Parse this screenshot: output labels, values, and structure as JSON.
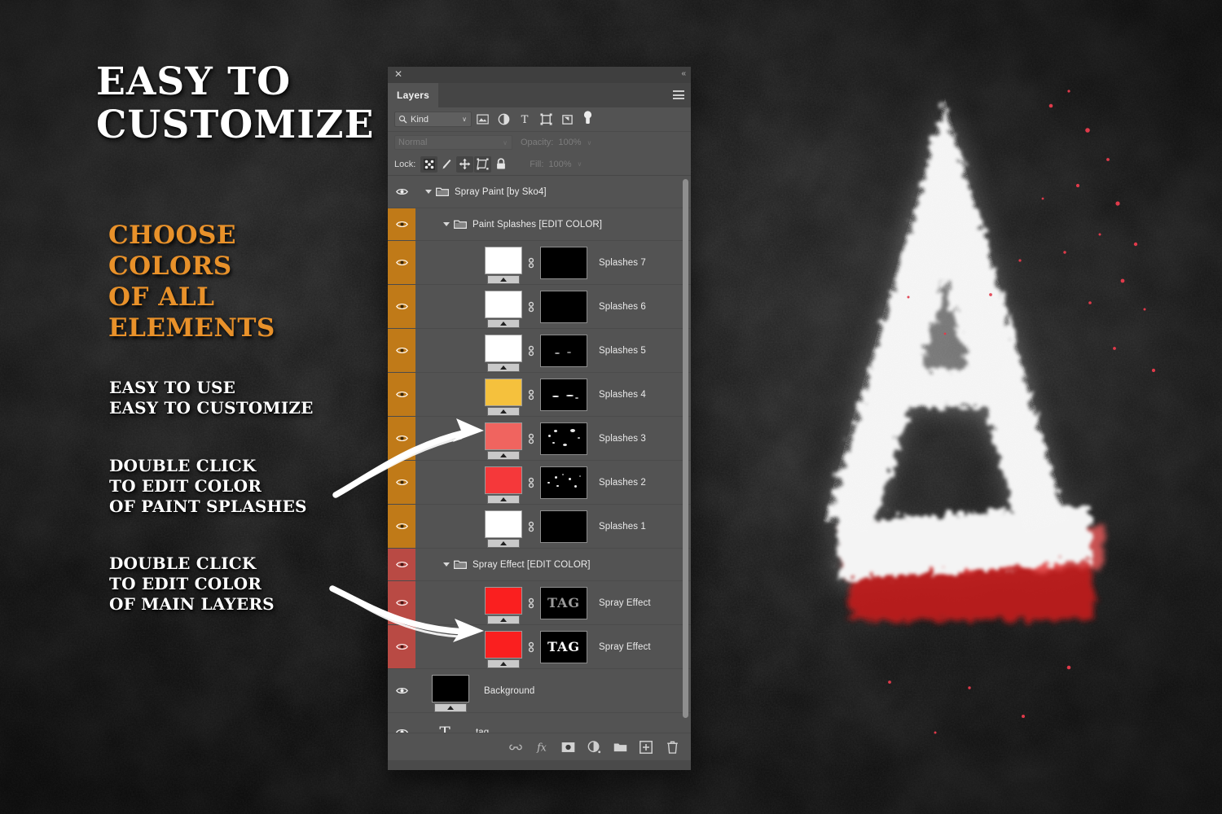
{
  "background": {
    "texture": "dark-concrete",
    "base_color": "#121212"
  },
  "marketing": {
    "headline": {
      "lines": [
        "EASY TO",
        "CUSTOMIZE"
      ],
      "color": "#FFFFFF"
    },
    "subhead": {
      "lines": [
        "CHOOSE",
        "COLORS",
        "OF ALL",
        "ELEMENTS"
      ],
      "color": "#E8912A"
    },
    "note_easy": {
      "lines": [
        "EASY TO USE",
        "EASY TO CUSTOMIZE"
      ],
      "color": "#FFFFFF"
    },
    "note_splashes": {
      "lines": [
        "DOUBLE CLICK",
        "TO EDIT COLOR",
        "OF PAINT SPLASHES"
      ],
      "color": "#FFFFFF"
    },
    "note_main": {
      "lines": [
        "DOUBLE CLICK",
        "TO EDIT COLOR",
        "OF MAIN LAYERS"
      ],
      "color": "#FFFFFF"
    },
    "arrows": [
      {
        "name": "arrow-to-splashes-3",
        "points_to": "Splashes 3 thumbnail"
      },
      {
        "name": "arrow-to-spray-effect",
        "points_to": "Spray Effect thumbnail"
      }
    ]
  },
  "artwork": {
    "letter": "A",
    "stroke_color": "#F2F2F2",
    "accent_color": "#E8403F",
    "description": "spray painted letter A with red stripe on dark concrete"
  },
  "panel": {
    "title": "Layers",
    "close_label": "✕",
    "collapse_label": "«",
    "menu_label": "panel-menu",
    "filter": {
      "search_label": "Kind",
      "chevron": "∨",
      "icons": [
        "pixel-layer-icon",
        "adjustment-layer-icon",
        "type-layer-icon",
        "shape-layer-icon",
        "smart-object-icon"
      ],
      "toggle": "filter-toggle"
    },
    "blend": {
      "mode": "Normal",
      "chevron": "∨",
      "opacity_label": "Opacity:",
      "opacity_value": "100%"
    },
    "lock": {
      "label": "Lock:",
      "buttons": [
        "lock-transparency-icon",
        "lock-image-icon",
        "lock-position-icon",
        "lock-artboard-icon",
        "lock-all-icon"
      ],
      "fill_label": "Fill:",
      "fill_value": "100%"
    },
    "rows": [
      {
        "type": "group",
        "name": "Spray Paint [by Sko4]",
        "indent": 0,
        "eye": "on",
        "eye_bg": "none"
      },
      {
        "type": "group",
        "name": "Paint Splashes [EDIT COLOR]",
        "indent": 1,
        "eye": "on",
        "eye_bg": "orange"
      },
      {
        "type": "layer",
        "name": "Splashes 7",
        "eye": "on",
        "eye_bg": "orange",
        "thumb_color": "#FFFFFF",
        "linked": true,
        "mask": "black",
        "mask_dots": 0
      },
      {
        "type": "layer",
        "name": "Splashes 6",
        "eye": "on",
        "eye_bg": "orange",
        "thumb_color": "#FFFFFF",
        "linked": true,
        "mask": "black",
        "mask_dots": 0
      },
      {
        "type": "layer",
        "name": "Splashes 5",
        "eye": "on",
        "eye_bg": "orange",
        "thumb_color": "#FFFFFF",
        "linked": true,
        "mask": "black",
        "mask_dots": 2
      },
      {
        "type": "layer",
        "name": "Splashes 4",
        "eye": "on",
        "eye_bg": "orange",
        "thumb_color": "#F5C13D",
        "linked": true,
        "mask": "black",
        "mask_dots": 3
      },
      {
        "type": "layer",
        "name": "Splashes 3",
        "eye": "on",
        "eye_bg": "orange",
        "thumb_color": "#F0645F",
        "linked": true,
        "mask": "black",
        "mask_dots": 6
      },
      {
        "type": "layer",
        "name": "Splashes 2",
        "eye": "on",
        "eye_bg": "orange",
        "thumb_color": "#F5383A",
        "linked": true,
        "mask": "black",
        "mask_dots": 7
      },
      {
        "type": "layer",
        "name": "Splashes 1",
        "eye": "on",
        "eye_bg": "orange",
        "thumb_color": "#FFFFFF",
        "linked": true,
        "mask": "black",
        "mask_dots": 0
      },
      {
        "type": "group",
        "name": "Spray Effect [EDIT COLOR]",
        "indent": 1,
        "eye": "on",
        "eye_bg": "red"
      },
      {
        "type": "layer",
        "name": "Spray Effect",
        "eye": "on",
        "eye_bg": "red",
        "thumb_color": "#FA1F1F",
        "linked": true,
        "mask": "tag",
        "mask_text": "TAG",
        "mask_text_color": "#9b9b9b"
      },
      {
        "type": "layer",
        "name": "Spray Effect",
        "eye": "on",
        "eye_bg": "red",
        "thumb_color": "#FA1F1F",
        "linked": true,
        "mask": "tag",
        "mask_text": "TAG",
        "mask_text_color": "#FFFFFF"
      },
      {
        "type": "layer",
        "name": "Background",
        "eye": "on",
        "eye_bg": "none",
        "thumb_color": "#000000",
        "linked": false,
        "mask": "none"
      },
      {
        "type": "text-layer",
        "name": "tag",
        "eye": "on",
        "eye_bg": "none",
        "icon": "type-T-icon"
      }
    ],
    "bottom_toolbar": [
      {
        "name": "link-layers-icon",
        "label": "link"
      },
      {
        "name": "layer-style-fx-icon",
        "label": "fx"
      },
      {
        "name": "add-layer-mask-icon",
        "label": "mask"
      },
      {
        "name": "new-adjustment-layer-icon",
        "label": "adjustment"
      },
      {
        "name": "new-group-icon",
        "label": "group"
      },
      {
        "name": "new-layer-icon",
        "label": "new"
      },
      {
        "name": "delete-layer-icon",
        "label": "delete"
      }
    ],
    "colors": {
      "panel_bg": "#535353",
      "eye_orange": "#C07A18",
      "eye_red": "#B94A44",
      "tab_bg": "#454545"
    }
  }
}
